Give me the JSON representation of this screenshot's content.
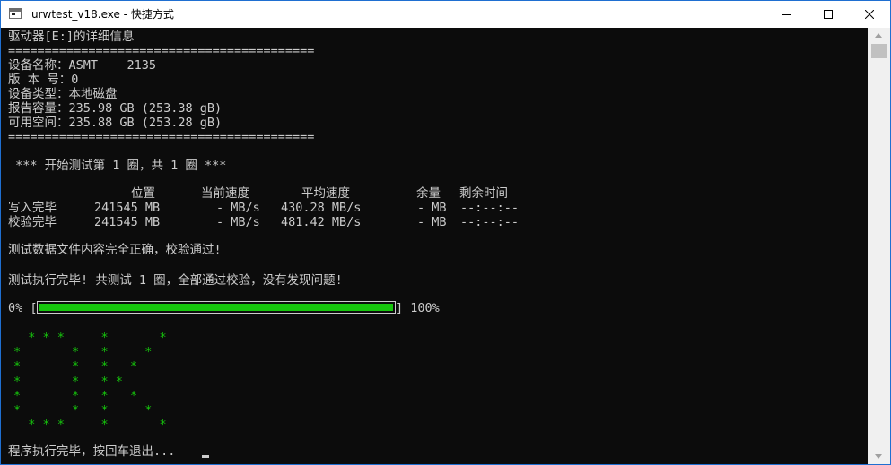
{
  "window": {
    "title": "urwtest_v18.exe - 快捷方式"
  },
  "console": {
    "drive_header": "驱动器[E:]的详细信息",
    "separator": "==========================================",
    "device_name": "设备名称：ASMT    2135",
    "version": "版 本 号：0",
    "device_type": "设备类型：本地磁盘",
    "reported_capacity": "报告容量：235.98 GB (253.38 gB)",
    "available_space": "可用空间：235.88 GB (253.28 gB)",
    "test_start": " *** 开始测试第 1 圈，共 1 圈 ***",
    "table": {
      "headers": {
        "position": "位置",
        "current_speed": "当前速度",
        "average_speed": "平均速度",
        "remaining": "余量",
        "time_left": "剩余时间"
      },
      "rows": [
        {
          "label": "写入完毕",
          "position": "241545 MB",
          "current_speed": "- MB/s",
          "average_speed": "430.28 MB/s",
          "remaining": "- MB",
          "time_left": "--:--:--"
        },
        {
          "label": "校验完毕",
          "position": "241545 MB",
          "current_speed": "- MB/s",
          "average_speed": "481.42 MB/s",
          "remaining": "- MB",
          "time_left": "--:--:--"
        }
      ]
    },
    "verify_message": "测试数据文件内容完全正确，校验通过!",
    "complete_message": "测试执行完毕! 共测试 1 圈，全部通过校验，没有发现问题!",
    "progress": {
      "left_label": "0% [",
      "right_label": "] 100%",
      "percent": 100,
      "fill_color": "#16c60c"
    },
    "ok_banner": "  * * *     *       *\n*       *   *     *\n*       *   *   *\n*       *   * *\n*       *   *   *\n*       *   *     *\n  * * *     *       *",
    "exit_prompt": "程序执行完毕，按回车退出..."
  },
  "colors": {
    "console_bg": "#0c0c0c",
    "console_text": "#cccccc",
    "accent_green": "#16c60c",
    "window_border": "#1f6fd1"
  }
}
